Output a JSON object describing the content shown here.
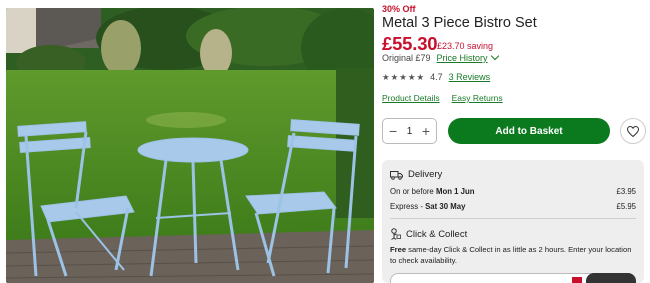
{
  "product": {
    "discount_badge": "30% Off",
    "title": "Metal 3 Piece Bistro Set",
    "price": "£55.30",
    "saving": "£23.70 saving",
    "original_price": "Original £79",
    "price_history_link": "Price History",
    "rating_value": "4.7",
    "rating_stars": 4.5,
    "reviews_link": "3 Reviews",
    "product_details_link": "Product Details",
    "easy_returns_link": "Easy Returns",
    "image_icon": "bistro-set-photo"
  },
  "purchase": {
    "quantity": "1",
    "add_to_basket_label": "Add to Basket",
    "wishlist_icon": "heart-icon"
  },
  "delivery": {
    "heading": "Delivery",
    "options": [
      {
        "label_prefix": "On or before ",
        "label_bold": "Mon 1 Jun",
        "price": "£3.95"
      },
      {
        "label_prefix": "Express - ",
        "label_bold": "Sat 30 May",
        "price": "£5.95"
      }
    ]
  },
  "click_collect": {
    "heading": "Click & Collect",
    "text_bold": "Free",
    "text_rest": " same-day Click & Collect in as little as 2 hours. Enter your location to check availability."
  },
  "colors": {
    "accent_red": "#c8102e",
    "button_green": "#0b7a1f",
    "link_green": "#1a7a2a",
    "panel_bg": "#eeeeee"
  }
}
